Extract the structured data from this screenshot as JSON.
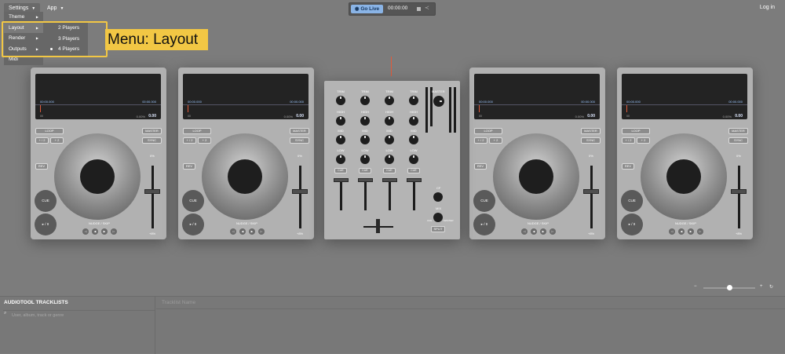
{
  "topbar": {
    "settings_label": "Settings",
    "app_label": "App",
    "go_live_label": "Go Live",
    "timer": "00:00:00",
    "login_label": "Log in"
  },
  "settings_menu": {
    "items": [
      {
        "label": "Theme"
      },
      {
        "label": "Layout"
      },
      {
        "label": "Render"
      },
      {
        "label": "Outputs"
      },
      {
        "label": "Midi"
      }
    ],
    "layout_options": [
      {
        "label": "2 Players",
        "selected": false
      },
      {
        "label": "3 Players",
        "selected": false
      },
      {
        "label": "4 Players",
        "selected": true
      }
    ]
  },
  "callout": {
    "text": "Menu: Layout",
    "color": "#f2c744"
  },
  "deck": {
    "time_left": "00:00.000",
    "time_right": "00:00.000",
    "zero": "00",
    "pitch_pct": "0.00%",
    "value": "0.00",
    "loop_label": "LOOP",
    "half_label": "+ / 2",
    "double_label": "+ 2",
    "master_label": "MASTER",
    "sync_label": "SYNC",
    "rev_label": "REV",
    "cue_label": "CUE",
    "play_label": "▸ / II",
    "nudge_label": "NUDGE / SKIP",
    "pitch_top": "0%",
    "pitch_bottom": "+8%",
    "nudge_buttons": [
      "◁",
      "◀",
      "▶",
      "▷"
    ]
  },
  "mixer": {
    "trim": "TRIM",
    "high": "HIGH",
    "mid": "MID",
    "low": "LOW",
    "cue": "CUE",
    "master": "MASTER",
    "cf_label": "CF",
    "mix_label": "MIX",
    "cue_side": "CUE",
    "master_side": "MASTER",
    "split_label": "SPLIT"
  },
  "zoom": {
    "minus": "−",
    "plus": "+",
    "reset": "↻",
    "level": 0.5
  },
  "bottom": {
    "panel_title": "AUDIOTOOL TRACKLISTS",
    "search_placeholder": "User, album, track or genre",
    "tracklist_placeholder": "Tracklist Name"
  },
  "colors": {
    "accent": "#8ab4e6",
    "marker": "#e05a3a",
    "highlight": "#f2c744"
  }
}
